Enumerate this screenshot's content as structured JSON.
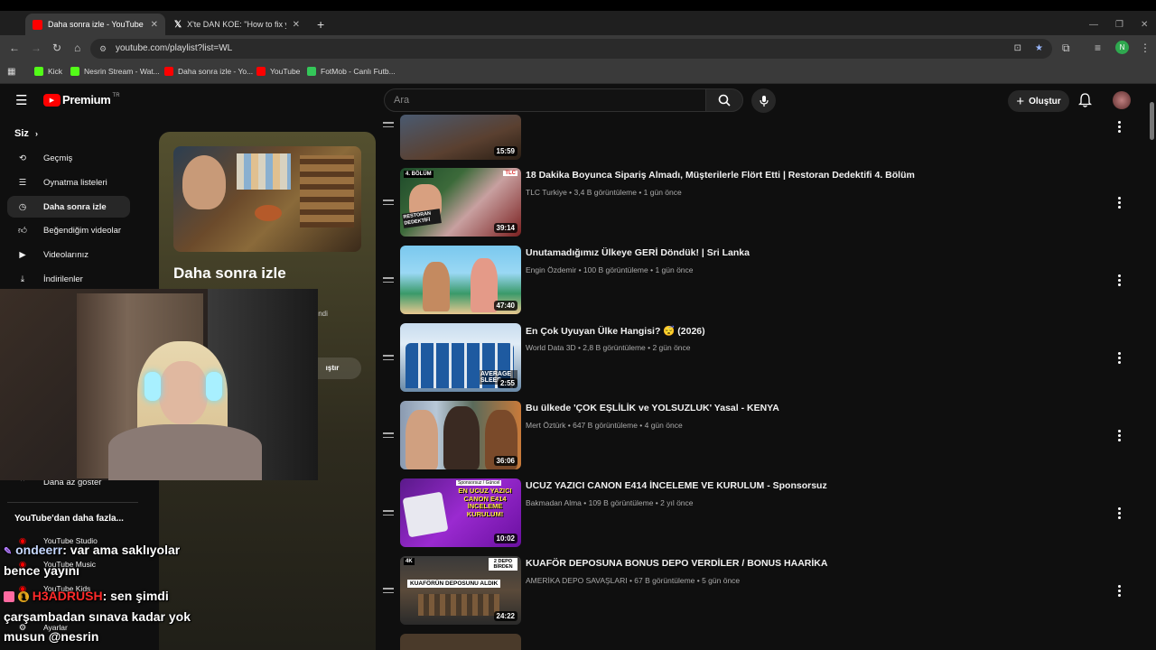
{
  "browser": {
    "tabs": [
      {
        "label": "Daha sonra izle - YouTube",
        "active": true,
        "color": "#ff0000"
      },
      {
        "label": "X'te DAN KOE: \"How to fix your",
        "active": false,
        "color": "#ffffff"
      }
    ],
    "url": "youtube.com/playlist?list=WL",
    "profile_initial": "N",
    "bookmarks": [
      {
        "label": "Kick",
        "color": "#53fc18"
      },
      {
        "label": "Nesrin Stream - Wat...",
        "color": "#53fc18"
      },
      {
        "label": "Daha sonra izle - Yo...",
        "color": "#ff0000"
      },
      {
        "label": "YouTube",
        "color": "#ff0000"
      },
      {
        "label": "FotMob - Canlı Futb...",
        "color": "#34c759"
      }
    ]
  },
  "youtube": {
    "logo_text": "Premium",
    "logo_region": "TR",
    "search_placeholder": "Ara",
    "create_label": "Oluştur"
  },
  "sidebar": {
    "section_label": "Siz",
    "items": [
      {
        "label": "Geçmiş",
        "icon": "history-icon"
      },
      {
        "label": "Oynatma listeleri",
        "icon": "playlists-icon"
      },
      {
        "label": "Daha sonra izle",
        "icon": "clock-icon",
        "active": true
      },
      {
        "label": "Beğendiğim videolar",
        "icon": "thumbs-up-icon"
      },
      {
        "label": "Videolarınız",
        "icon": "video-icon"
      },
      {
        "label": "İndirilenler",
        "icon": "download-icon"
      }
    ],
    "show_less": "Daha az göster",
    "more_section": "YouTube'dan daha fazla...",
    "more_items": [
      "YouTube Studio",
      "YouTube Music",
      "YouTube Kids"
    ],
    "settings": "Ayarlar"
  },
  "playlist": {
    "title": "Daha sonra izle",
    "partial_text_1": "lendi",
    "partial_text_2": "ıştır"
  },
  "videos": [
    {
      "title": "",
      "meta": "",
      "duration": "15:59"
    },
    {
      "title": "18 Dakika Boyunca Sipariş Almadı, Müşterilerle Flört Etti | Restoran Dedektifi 4. Bölüm",
      "meta": "TLC Turkiye • 3,4 B görüntüleme • 1 gün önce",
      "duration": "39:14"
    },
    {
      "title": "Unutamadığımız Ülkeye GERİ Döndük! | Sri Lanka",
      "meta": "Engin Özdemir • 100 B görüntüleme • 1 gün önce",
      "duration": "47:40"
    },
    {
      "title": "En Çok Uyuyan Ülke Hangisi? 😴 (2026)",
      "meta": "World Data 3D • 2,8 B görüntüleme • 2 gün önce",
      "duration": "2:55"
    },
    {
      "title": "Bu ülkede 'ÇOK EŞLİLİK ve YOLSUZLUK' Yasal - KENYA",
      "meta": "Mert Öztürk • 647 B görüntüleme • 4 gün önce",
      "duration": "36:06"
    },
    {
      "title": "UCUZ YAZICI CANON E414 İNCELEME VE KURULUM - Sponsorsuz",
      "meta": "Bakmadan Alma • 109 B görüntüleme • 2 yıl önce",
      "duration": "10:02"
    },
    {
      "title": "KUAFÖR DEPOSUNA BONUS DEPO VERDİLER / BONUS HAARİKA",
      "meta": "AMERİKA DEPO SAVAŞLARI • 67 B görüntüleme • 5 gün önce",
      "duration": "24:22"
    }
  ],
  "thumb_text": {
    "t2_badge": "4. BÖLÜM",
    "t2_show": "RESTORAN DEDEKTİFİ",
    "t2_channel": "TLC",
    "t4_text": "AVERAGE SLEEP",
    "t6_text": "EN UCUZ YAZICI CANON E414 İNCELEME KURULUM!",
    "t6_badge": "Sponsorsuz / Güncel",
    "t7_text": "KUAFÖRÜN DEPOSUNU ALDIK",
    "t7_badge": "2 DEPO BİRDEN"
  },
  "chat": [
    {
      "user": "ondeerr",
      "message": ": var ama saklıyolar",
      "cont": "bence yayını",
      "color": "#c6d8ff"
    },
    {
      "user": "H3ADRUSH",
      "message": ": sen şimdi",
      "cont": "çarşambadan sınava kadar yok",
      "cont2": "musun @nesrin",
      "color": "#ff2a2a"
    }
  ],
  "colors": {
    "accent_red": "#ff0000",
    "bg": "#0f0f0f",
    "text_secondary": "#aaaaaa"
  }
}
